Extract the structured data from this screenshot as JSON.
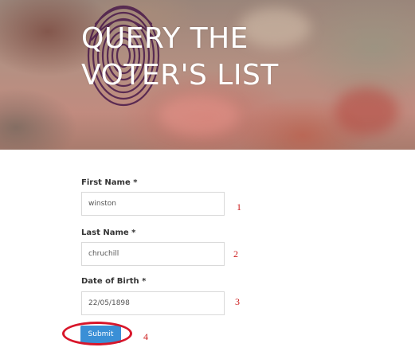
{
  "hero": {
    "title_line1": "QUERY THE",
    "title_line2": "VOTER'S LIST",
    "title_color": "#ffffff"
  },
  "form": {
    "fields": [
      {
        "label": "First Name *",
        "value": "winston",
        "annotation": "1"
      },
      {
        "label": "Last Name *",
        "value": "chruchill",
        "annotation": "2"
      },
      {
        "label": "Date of Birth *",
        "value": "22/05/1898",
        "annotation": "3"
      }
    ],
    "submit_label": "Submit",
    "submit_annotation": "4",
    "button_color": "#3a8fd6",
    "annotation_color": "#cc1a1a"
  }
}
